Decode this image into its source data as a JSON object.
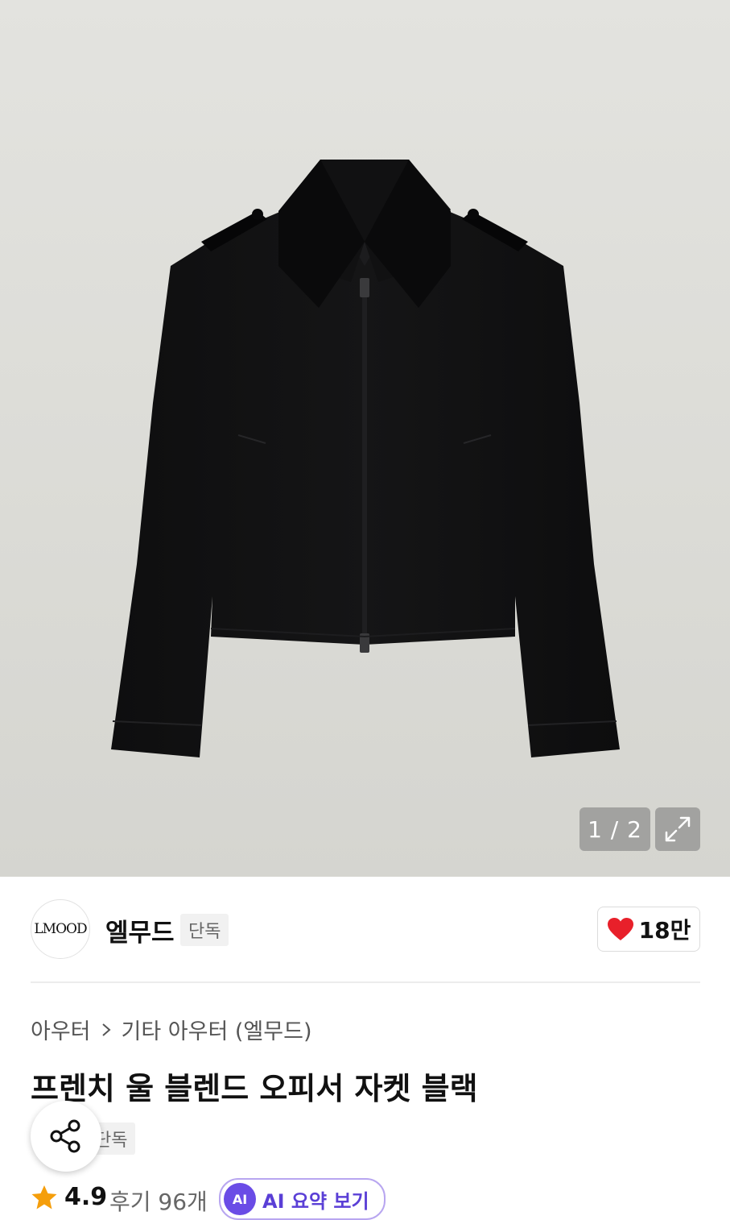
{
  "gallery": {
    "counter": "1 / 2",
    "expand_icon": "expand-icon"
  },
  "brand": {
    "logo_text": "LMOOD",
    "name": "엘무드",
    "tag": "단독"
  },
  "like": {
    "icon": "heart-icon",
    "color": "#e8202a",
    "count": "18만"
  },
  "breadcrumb": {
    "level1": "아우터",
    "separator_icon": "chevron-right-icon",
    "level2": "기타 아우터 (엘무드)"
  },
  "product": {
    "title": "프렌치 울 블렌드 오피서 자켓 블랙",
    "tag": "단독"
  },
  "share": {
    "icon": "share-icon"
  },
  "rating": {
    "star_icon": "star-icon",
    "star_color": "#f59e0b",
    "score": "4.9",
    "review_label": "후기 96개",
    "ai_badge": "AI",
    "ai_label": "AI 요약 보기",
    "ai_color": "#6a4ce6"
  }
}
